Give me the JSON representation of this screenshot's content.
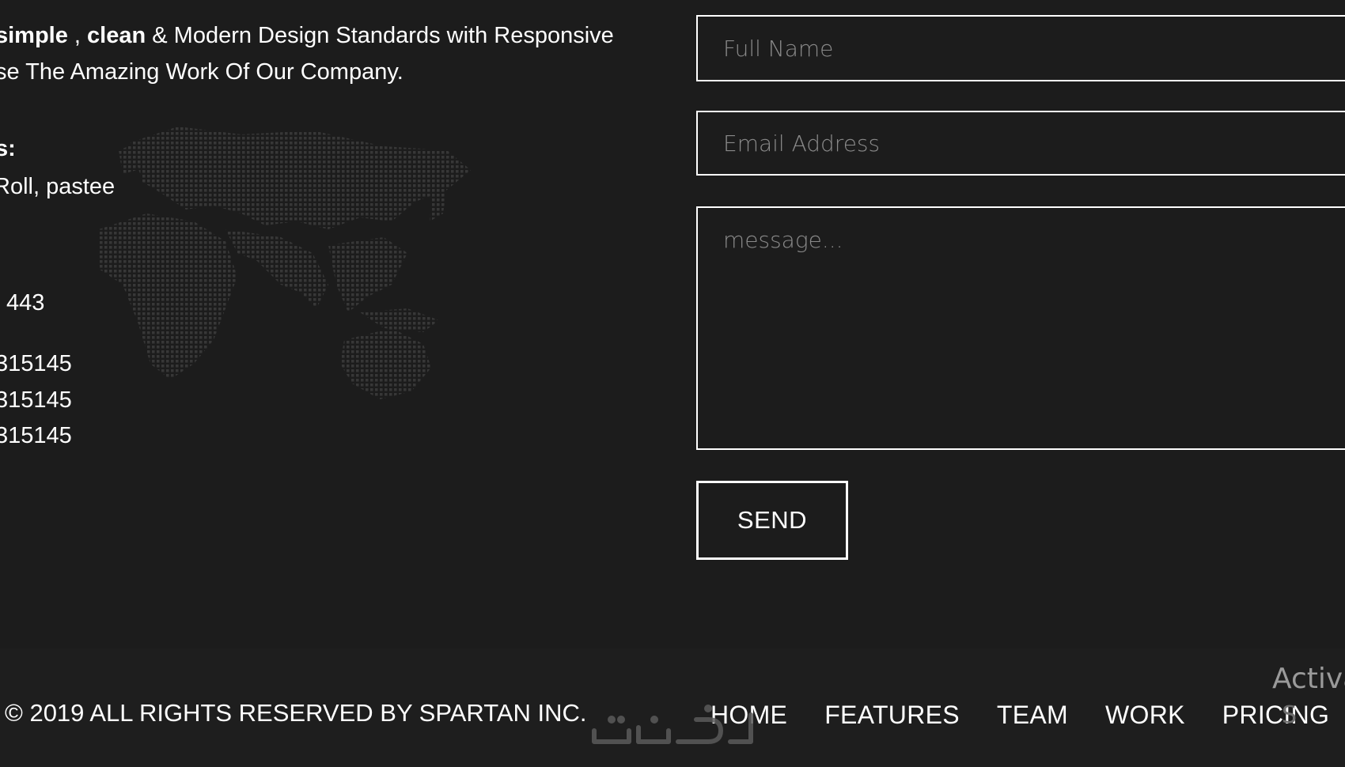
{
  "intro": {
    "line1_bold1": "simple",
    "line1_sep": " , ",
    "line1_bold2": "clean",
    "line1_rest": " & Modern Design Standards with Responsive",
    "line2": "se The Amazing Work Of Our Company."
  },
  "contact_info": {
    "address_label": "s:",
    "address_value": "Roll, pastee",
    "po_box": "443",
    "phones": [
      "315145",
      "315145",
      "315145"
    ]
  },
  "form": {
    "name_placeholder": "Full Name",
    "email_placeholder": "Email Address",
    "message_placeholder": "message...",
    "send_label": "SEND"
  },
  "footer": {
    "copyright": "© 2019 ALL RIGHTS RESERVED BY SPARTAN INC.",
    "nav": [
      "HOME",
      "FEATURES",
      "TEAM",
      "WORK",
      "PRICING"
    ]
  },
  "overlays": {
    "watermark_text": "خمسات",
    "activate_text": "Activa",
    "activate_sub": "S"
  },
  "colors": {
    "background": "#1c1c1c",
    "footer_background": "#1e1e1e",
    "text": "#ffffff",
    "placeholder": "#8a8a8a",
    "map_dots": "#3a3a3a"
  }
}
